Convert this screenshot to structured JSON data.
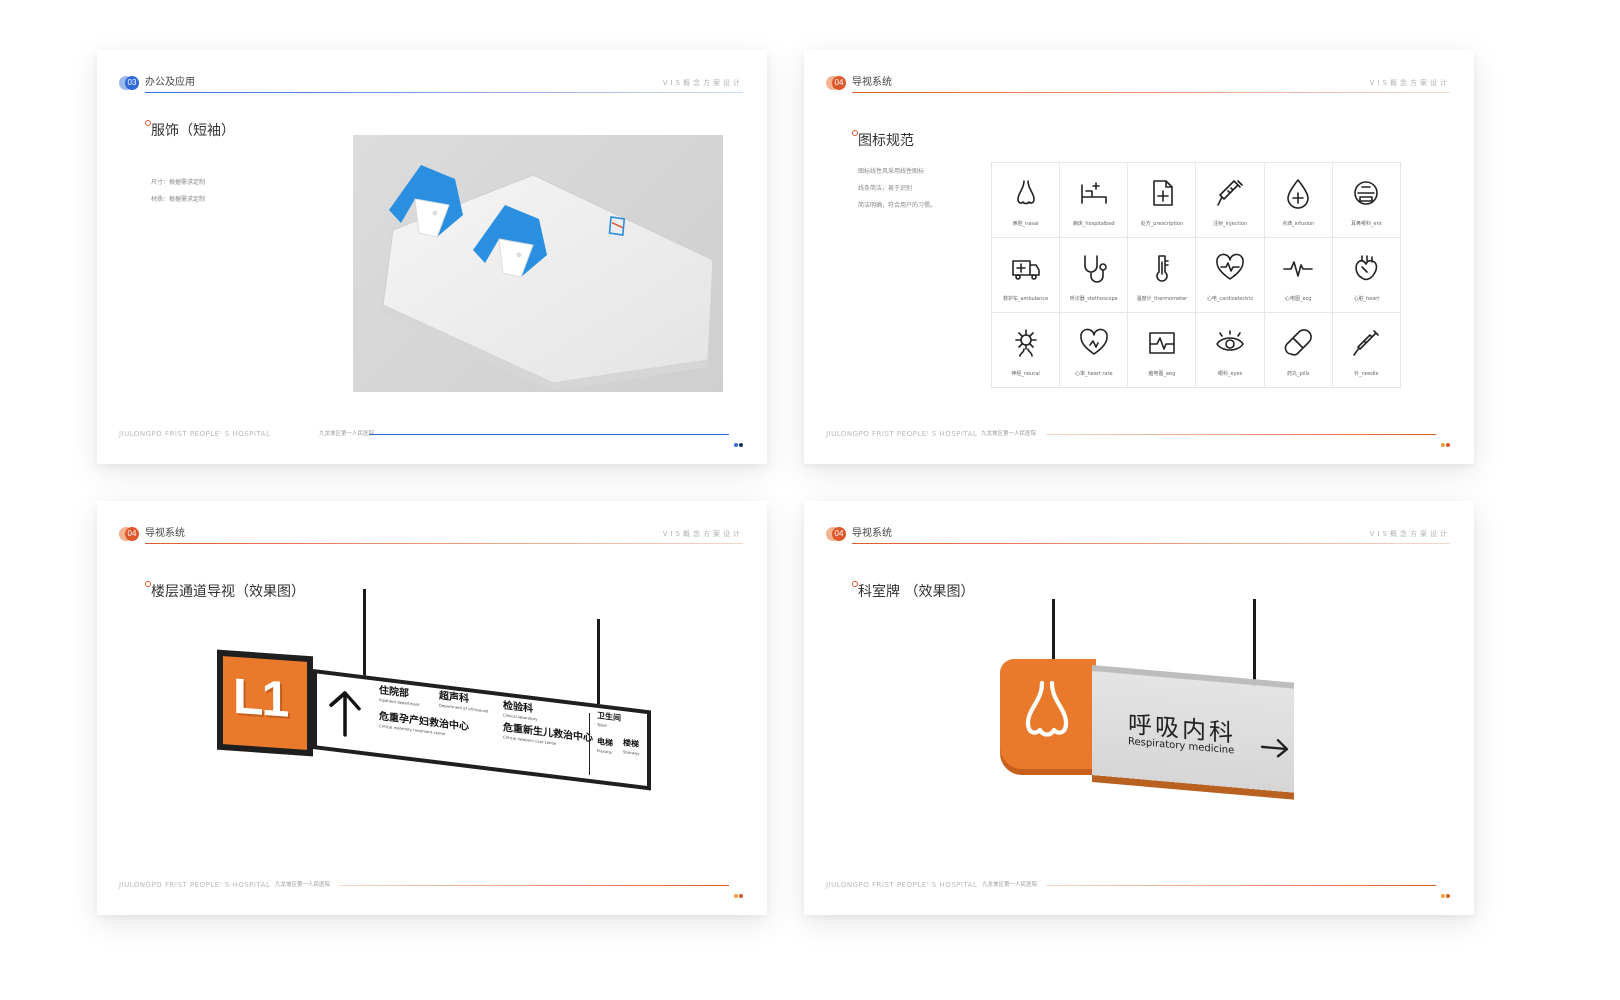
{
  "colors": {
    "blue_accent": "#2f6bd8",
    "orange_accent": "#e0572a",
    "sign_orange": "#ea7a2b",
    "polo_collar_blue": "#2a8fe0"
  },
  "slides": [
    {
      "header": {
        "badge": "03",
        "title": "办公及应用",
        "right": "VIS概念方案设计"
      },
      "section_title": "服饰（短袖）",
      "notes": [
        "尺寸：根据需求定制",
        "材质：根据需求定制"
      ],
      "footer": {
        "en": "JIULONGPO FRIST PEOPLE' S HOSPITAL",
        "cn": "九龙坡区第一人民医院"
      }
    },
    {
      "header": {
        "badge": "04",
        "title": "导视系统",
        "right": "VIS概念方案设计"
      },
      "section_title": "图标规范",
      "notes": [
        "图标线性风采用线性图标",
        "线条简洁，易于识别",
        "简洁明确，符合用户的习惯。"
      ],
      "icons": [
        {
          "name": "nose-icon",
          "label": "鼻腔_nasal"
        },
        {
          "name": "hospital-bed-icon",
          "label": "病床_hospitalbed"
        },
        {
          "name": "prescription-icon",
          "label": "处方_prescription"
        },
        {
          "name": "syringe-icon",
          "label": "注射_injection"
        },
        {
          "name": "drop-icon",
          "label": "点滴_infusion"
        },
        {
          "name": "ent-icon",
          "label": "耳鼻喉科_ent"
        },
        {
          "name": "ambulance-icon",
          "label": "救护车_ambulance"
        },
        {
          "name": "stethoscope-icon",
          "label": "听诊器_stethoscope"
        },
        {
          "name": "thermometer-icon",
          "label": "温度计_thermometer"
        },
        {
          "name": "heart-pulse-icon",
          "label": "心电_cardioelectric"
        },
        {
          "name": "ecg-icon",
          "label": "心电图_ecg"
        },
        {
          "name": "heart-organ-icon",
          "label": "心脏_heart"
        },
        {
          "name": "neural-icon",
          "label": "神经_neural"
        },
        {
          "name": "heart-rate-icon",
          "label": "心率_heart rate"
        },
        {
          "name": "eeg-icon",
          "label": "脑电图_eeg"
        },
        {
          "name": "eye-icon",
          "label": "眼科_eyes"
        },
        {
          "name": "pill-icon",
          "label": "药丸_pills"
        },
        {
          "name": "needle-icon",
          "label": "针_needle"
        }
      ],
      "footer": {
        "en": "JIULONGPO FRIST PEOPLE' S HOSPITAL",
        "cn": "九龙坡区第一人民医院"
      }
    },
    {
      "header": {
        "badge": "04",
        "title": "导视系统",
        "right": "VIS概念方案设计"
      },
      "section_title": "楼层通道导视（效果图）",
      "sign": {
        "floor": "L1",
        "items": [
          {
            "cn": "住院部",
            "en": "Inpatient department"
          },
          {
            "cn": "超声科",
            "en": "Department of ultrasound"
          },
          {
            "cn": "检验科",
            "en": "Clinical laboratory"
          },
          {
            "cn": "危重孕产妇救治中心",
            "en": "Critical maternity treatment center"
          },
          {
            "cn": "危重新生儿救治中心",
            "en": "Critical newborn care center"
          },
          {
            "cn": "卫生间",
            "en": "Toilet"
          },
          {
            "cn": "电梯",
            "en": "Elevator"
          },
          {
            "cn": "楼梯",
            "en": "Stairway"
          }
        ]
      },
      "footer": {
        "en": "JIULONGPO FRIST PEOPLE' S HOSPITAL",
        "cn": "九龙坡区第一人民医院"
      }
    },
    {
      "header": {
        "badge": "04",
        "title": "导视系统",
        "right": "VIS概念方案设计"
      },
      "section_title": "科室牌 （效果图）",
      "sign": {
        "cn": "呼吸内科",
        "en": "Respiratory medicine"
      },
      "footer": {
        "en": "JIULONGPO FRIST PEOPLE' S HOSPITAL",
        "cn": "九龙坡区第一人民医院"
      }
    }
  ]
}
